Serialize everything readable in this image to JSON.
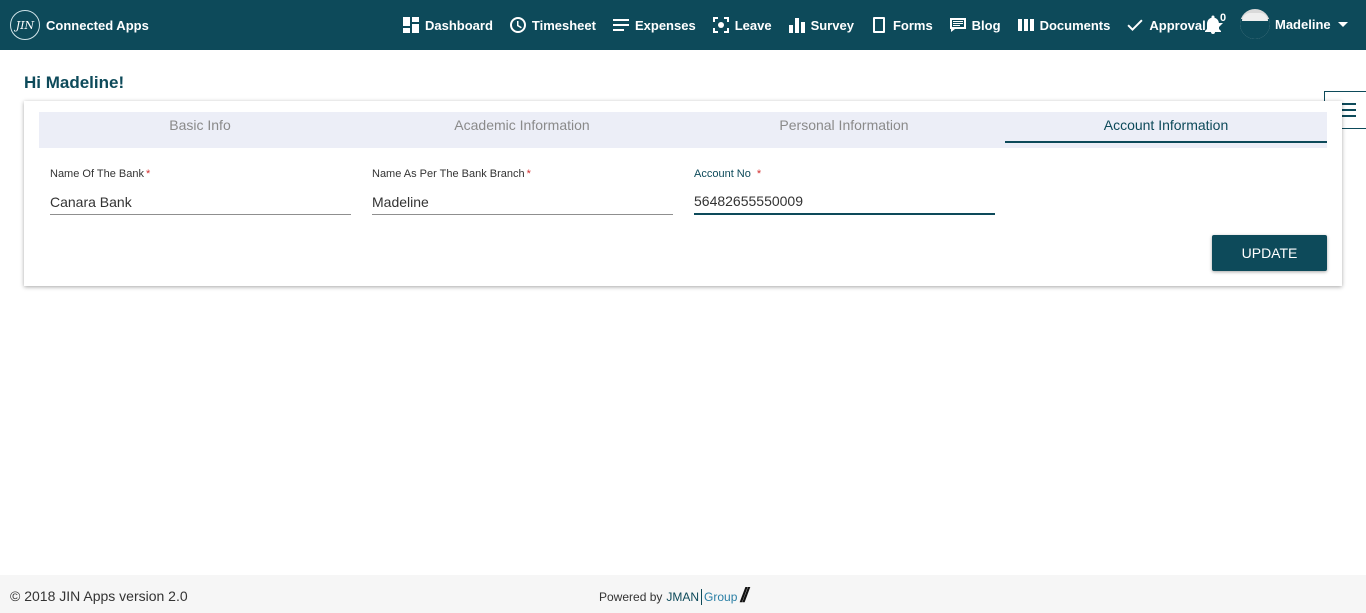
{
  "header": {
    "logo_text": "JIN",
    "app_name": "Connected Apps",
    "nav": [
      {
        "label": "Dashboard",
        "icon": "dashboard-icon"
      },
      {
        "label": "Timesheet",
        "icon": "clock-icon"
      },
      {
        "label": "Expenses",
        "icon": "list-icon"
      },
      {
        "label": "Leave",
        "icon": "leave-icon"
      },
      {
        "label": "Survey",
        "icon": "bar-chart-icon"
      },
      {
        "label": "Forms",
        "icon": "form-icon"
      },
      {
        "label": "Blog",
        "icon": "blog-icon"
      },
      {
        "label": "Documents",
        "icon": "documents-icon"
      },
      {
        "label": "Approval",
        "icon": "check-icon"
      }
    ],
    "notification_count": "0",
    "user_name": "Madeline"
  },
  "greeting": "Hi Madeline!",
  "tabs": [
    {
      "label": "Basic Info",
      "active": false
    },
    {
      "label": "Academic Information",
      "active": false
    },
    {
      "label": "Personal Information",
      "active": false
    },
    {
      "label": "Account Information",
      "active": true
    }
  ],
  "form": {
    "bank_name": {
      "label": "Name Of The Bank",
      "value": "Canara Bank"
    },
    "branch_name": {
      "label": "Name As Per The Bank Branch",
      "value": "Madeline"
    },
    "account_no": {
      "label": "Account No",
      "value": "56482655550009"
    },
    "required_mark": "*",
    "update_label": "UPDATE"
  },
  "footer": {
    "copyright": "© 2018 JIN Apps version 2.0",
    "powered_by": "Powered by",
    "brand_jman": "JMAN",
    "brand_group": "Group",
    "brand_mark": "//"
  },
  "colors": {
    "primary": "#0d4a5a",
    "required": "#d32f2f",
    "tab_bg": "#eceef7"
  }
}
